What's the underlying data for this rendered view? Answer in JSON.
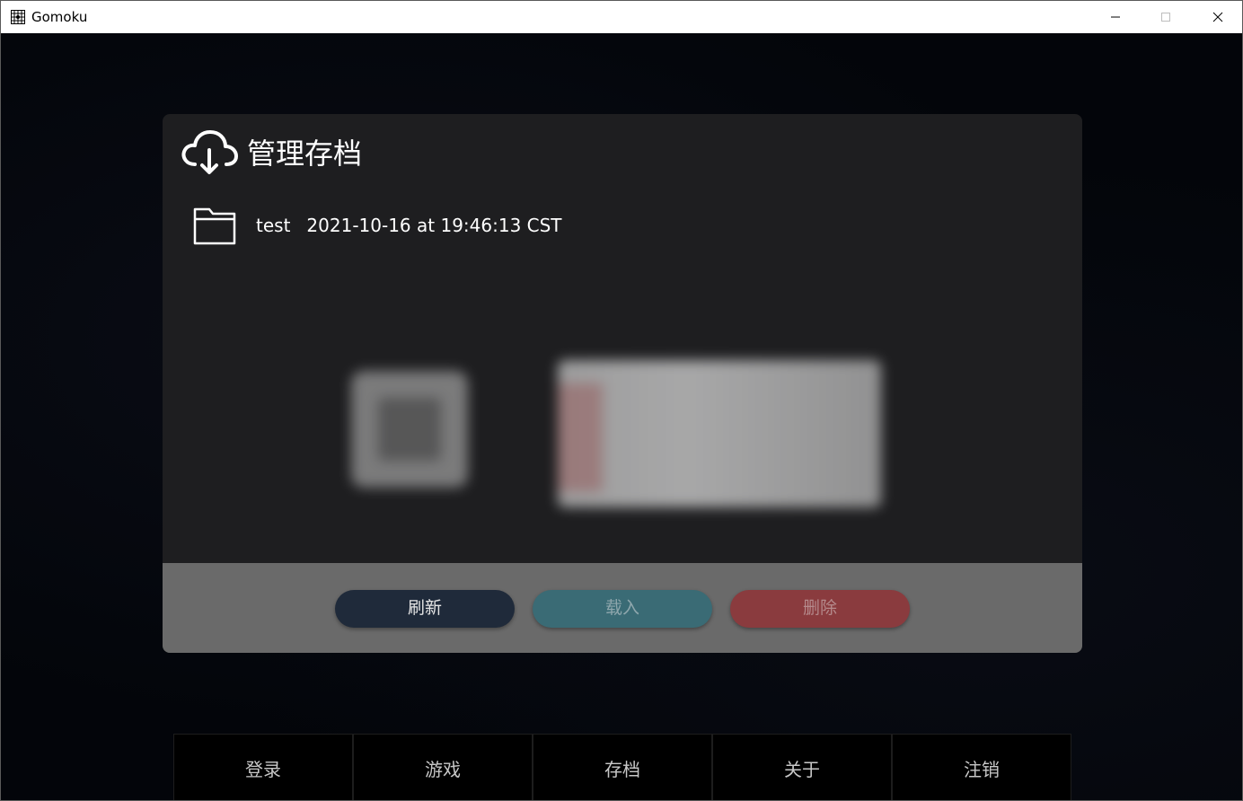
{
  "window": {
    "title": "Gomoku",
    "icons": {
      "app": "gomoku-board-icon",
      "minimize": "minimize-icon",
      "maximize": "maximize-icon",
      "close": "close-icon"
    }
  },
  "panel": {
    "title": "管理存档",
    "title_icon": "cloud-download-icon",
    "saves": [
      {
        "icon": "folder-icon",
        "name": "test",
        "date": "2021-10-16 at 19:46:13 CST"
      }
    ],
    "actions": {
      "refresh_label": "刷新",
      "load_label": "载入",
      "delete_label": "删除"
    }
  },
  "nav": {
    "items": [
      {
        "label": "登录"
      },
      {
        "label": "游戏"
      },
      {
        "label": "存档"
      },
      {
        "label": "关于"
      },
      {
        "label": "注销"
      }
    ]
  },
  "colors": {
    "panel_bg": "#1e1e20",
    "action_bar_bg": "#6a6a6a",
    "refresh_bg": "#1f2a3a",
    "load_bg": "#3a6b75",
    "delete_bg": "#8a3b3e"
  }
}
